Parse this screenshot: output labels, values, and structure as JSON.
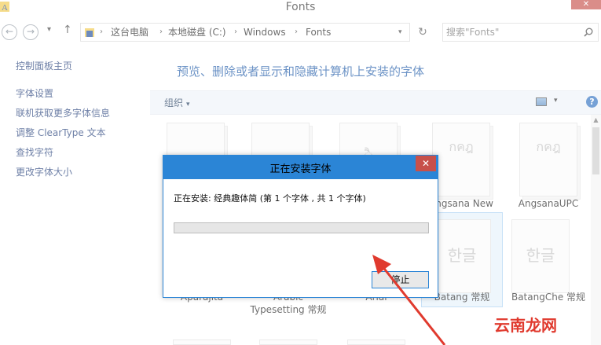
{
  "window": {
    "title": "Fonts",
    "close_glyph": "✕"
  },
  "nav": {
    "back_glyph": "←",
    "forward_glyph": "→",
    "recent_glyph": "▾",
    "up_glyph": "↑"
  },
  "breadcrumb": {
    "items": [
      "这台电脑",
      "本地磁盘 (C:)",
      "Windows",
      "Fonts"
    ],
    "separator": "›",
    "dropdown_glyph": "▾",
    "refresh_glyph": "↻"
  },
  "search": {
    "placeholder": "搜索\"Fonts\"",
    "icon": "search-icon"
  },
  "sidebar": {
    "items": [
      {
        "label": "控制面板主页"
      },
      {
        "label": "字体设置"
      },
      {
        "label": "联机获取更多字体信息"
      },
      {
        "label": "调整 ClearType 文本"
      },
      {
        "label": "查找字符"
      },
      {
        "label": "更改字体大小"
      }
    ]
  },
  "main": {
    "heading": "预览、删除或者显示和隐藏计算机上安装的字体"
  },
  "toolbar": {
    "organize_label": "组织",
    "caret": "▾",
    "help_label": "?"
  },
  "fonts": [
    {
      "label": "",
      "glyph": ""
    },
    {
      "label": "",
      "glyph": ""
    },
    {
      "label": "",
      "glyph": "ै"
    },
    {
      "label": "Angsana New",
      "glyph": "กคฎ"
    },
    {
      "label": "AngsanaUPC",
      "glyph": "กคฎ"
    },
    {
      "label": "Aparajita",
      "glyph": ""
    },
    {
      "label": "Arabic Typesetting 常规",
      "glyph": ""
    },
    {
      "label": "Arial",
      "glyph": ""
    },
    {
      "label": "Batang 常规",
      "glyph": "한글",
      "selected": true
    },
    {
      "label": "BatangChe 常规",
      "glyph": "한글"
    }
  ],
  "dialog": {
    "title": "正在安装字体",
    "close_glyph": "✕",
    "message": "正在安装: 经典趣体简 (第 1 个字体 , 共 1 个字体)",
    "progress": 0.0,
    "stop_label": "停止"
  },
  "watermark": {
    "text": "云南龙网"
  },
  "colors": {
    "accent": "#2b85d6",
    "close_red": "#c7504a",
    "arrow": "#e03a2e",
    "heading_blue": "#1e5aa8"
  }
}
